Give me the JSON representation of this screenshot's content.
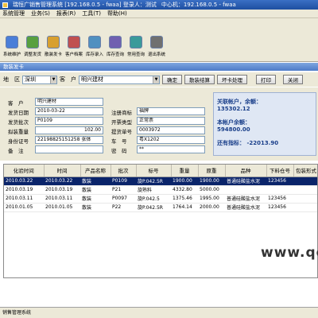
{
  "window": {
    "title": "瑞恒广销售管理系统 [192.168.0.5 - fwaa] 登录人：测试",
    "server": "中心机：192.168.0.5 - fwaa"
  },
  "menu": [
    "系统管理",
    "业务(S)",
    "报表(R)",
    "工具(T)",
    "帮助(H)"
  ],
  "toolbar": [
    {
      "label": "系统维护",
      "icon": "tools-icon",
      "color": "#4a7ed8"
    },
    {
      "label": "调整发货",
      "icon": "edit-icon",
      "color": "#58a040"
    },
    {
      "label": "散装发卡",
      "icon": "card-icon",
      "color": "#d8a030"
    },
    {
      "label": "客户档案",
      "icon": "contacts-icon",
      "color": "#c05050"
    },
    {
      "label": "库存录入",
      "icon": "warehouse-icon",
      "color": "#5090c0"
    },
    {
      "label": "库存查询",
      "icon": "search-icon",
      "color": "#7060b0"
    },
    {
      "label": "常用查询",
      "icon": "query-icon",
      "color": "#3a9a9a"
    },
    {
      "label": "退出系统",
      "icon": "exit-icon",
      "color": "#707070"
    }
  ],
  "form_title": "散装发卡",
  "filter": {
    "region_label": "地　区",
    "region_value": "深圳",
    "client_label": "客　户",
    "client_value": "明兴建材",
    "buttons": [
      "确定",
      "散装结算",
      "坏卡处理",
      "打印",
      "关闭"
    ]
  },
  "fields": {
    "client": {
      "label": "客　户",
      "value": "明兴建材"
    },
    "ship_date": {
      "label": "发货日期",
      "value": "2010-03-22"
    },
    "ship_no": {
      "label": "发货批次",
      "value": "P0109"
    },
    "weight": {
      "label": "拟装重量",
      "value": "102.00"
    },
    "idcard": {
      "label": "身份证号",
      "value": "22198825151258 张体"
    },
    "note": {
      "label": "备　注",
      "value": ""
    },
    "brand": {
      "label": "注册商标",
      "value": "福牌"
    },
    "invoice": {
      "label": "开票类型",
      "value": "正常票"
    },
    "pickup": {
      "label": "提货单号",
      "value": "0003972"
    },
    "plate": {
      "label": "车　号",
      "value": "粤X1202"
    },
    "password": {
      "label": "密　码",
      "value": "**"
    }
  },
  "account": {
    "linked_label": "关联帐户，余额：",
    "linked_value": "135302.12",
    "own_label": "本帐户余额：",
    "own_value": "594800.00",
    "quota_label": "还有指标：",
    "quota_value": "-22013.90"
  },
  "table": {
    "headers": [
      "化验时间",
      "时间",
      "产品名称",
      "批次",
      "标号",
      "重量",
      "原重",
      "品种",
      "下料仓号",
      "包装形式"
    ],
    "rows": [
      [
        "2010.03.22",
        "2010.03.22",
        "散装",
        "P0109",
        "旋P.042.5R",
        "1900.00",
        "1900.00",
        "普通硅酸盐水泥",
        "123456",
        ""
      ],
      [
        "2010.03.19",
        "2010.03.19",
        "散装",
        "P21",
        "旋熟料",
        "4332.80",
        "5000.00",
        "",
        "",
        ""
      ],
      [
        "2010.03.11",
        "2010.03.11",
        "散装",
        "P0097",
        "旋P.042.5",
        "1375.46",
        "1995.00",
        "普通硅酸盐水泥",
        "123456",
        ""
      ],
      [
        "2010.01.05",
        "2010.01.05",
        "散装",
        "P22",
        "旋P.042.5R",
        "1764.14",
        "2000.00",
        "普通硅酸盐水泥",
        "123456",
        ""
      ]
    ]
  },
  "watermark": "www.qc",
  "status": "销售管理系统"
}
